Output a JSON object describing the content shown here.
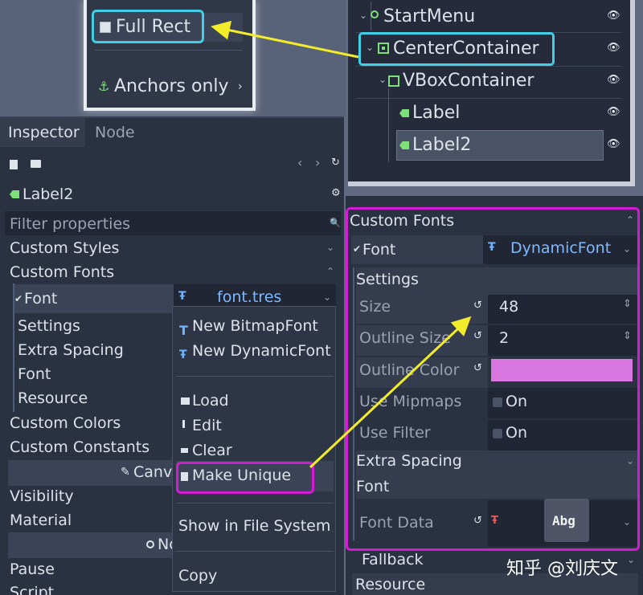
{
  "anchor_popup": {
    "full_rect": "Full Rect",
    "anchors_only": "Anchors only"
  },
  "scene_tree": {
    "items": [
      {
        "label": "StartMenu"
      },
      {
        "label": "CenterContainer"
      },
      {
        "label": "VBoxContainer"
      },
      {
        "label": "Label"
      },
      {
        "label": "Label2"
      }
    ]
  },
  "inspector": {
    "tabs": [
      "Inspector",
      "Node"
    ],
    "history_back": "‹",
    "history_fwd": "›",
    "node_name": "Label2",
    "filter_placeholder": "Filter properties",
    "sections": [
      "Custom Styles",
      "Custom Fonts"
    ],
    "font_prop": "Font",
    "font_value": "font.tres",
    "sub_props": [
      "Settings",
      "Extra Spacing",
      "Font",
      "Resource"
    ],
    "sections2": [
      "Custom Colors",
      "Custom Constants"
    ],
    "canvas_label": "Canva",
    "sections3": [
      "Visibility",
      "Material"
    ],
    "no_label": "No",
    "sections4": [
      "Pause",
      "Script"
    ]
  },
  "context_menu": {
    "items": [
      "New BitmapFont",
      "New DynamicFont",
      "Load",
      "Edit",
      "Clear",
      "Make Unique",
      "Show in File System",
      "Copy"
    ]
  },
  "font_panel": {
    "header": "Custom Fonts",
    "font_label": "Font",
    "font_value": "DynamicFont",
    "settings": "Settings",
    "size_label": "Size",
    "size_value": "48",
    "outline_size_label": "Outline Size",
    "outline_size_value": "2",
    "outline_color_label": "Outline Color",
    "outline_color": "#d977e0",
    "mipmaps_label": "Use Mipmaps",
    "mipmaps_value": "On",
    "filter_label": "Use Filter",
    "filter_value": "On",
    "extra_spacing": "Extra Spacing",
    "font_section": "Font",
    "font_data_label": "Font Data",
    "font_data_preview": "Abg",
    "fallback": "Fallback",
    "resource": "Resource"
  },
  "watermark": "知乎 @刘庆文",
  "colors": {
    "highlight_cyan": "#3fd0e8",
    "highlight_magenta": "#d31bd3",
    "arrow": "#f2ec2a",
    "accent_blue": "#6fb4ff"
  }
}
